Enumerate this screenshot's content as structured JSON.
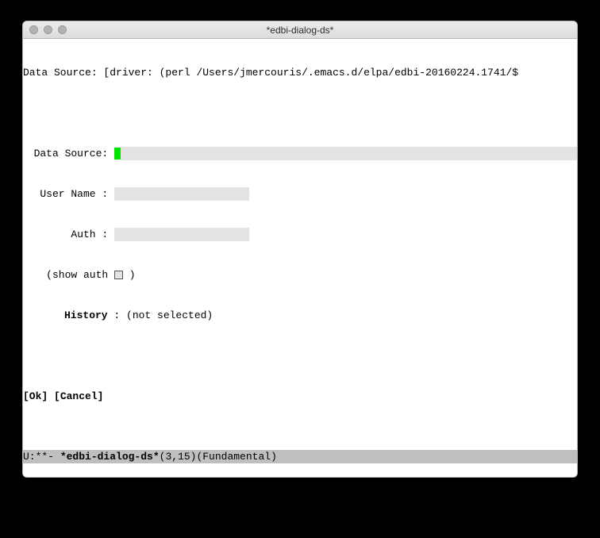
{
  "window": {
    "title": "*edbi-dialog-ds*"
  },
  "header": {
    "label": "Data Source: ",
    "driver_info": "[driver: (perl /Users/jmercouris/.emacs.d/elpa/edbi-20160224.1741/$"
  },
  "form": {
    "data_source_label": "Data Source: ",
    "user_name_label": "User Name : ",
    "auth_label": "Auth : ",
    "show_auth_prefix": "(show auth ",
    "show_auth_suffix": " )",
    "history_label": "History",
    "history_sep": " : ",
    "history_value": "(not selected)"
  },
  "buttons": {
    "ok": "[Ok]",
    "cancel": "[Cancel]"
  },
  "modeline": {
    "left": "U:**- ",
    "buffer_name": "*edbi-dialog-ds*",
    "position": "(3,15)",
    "mode": "(Fundamental)"
  }
}
